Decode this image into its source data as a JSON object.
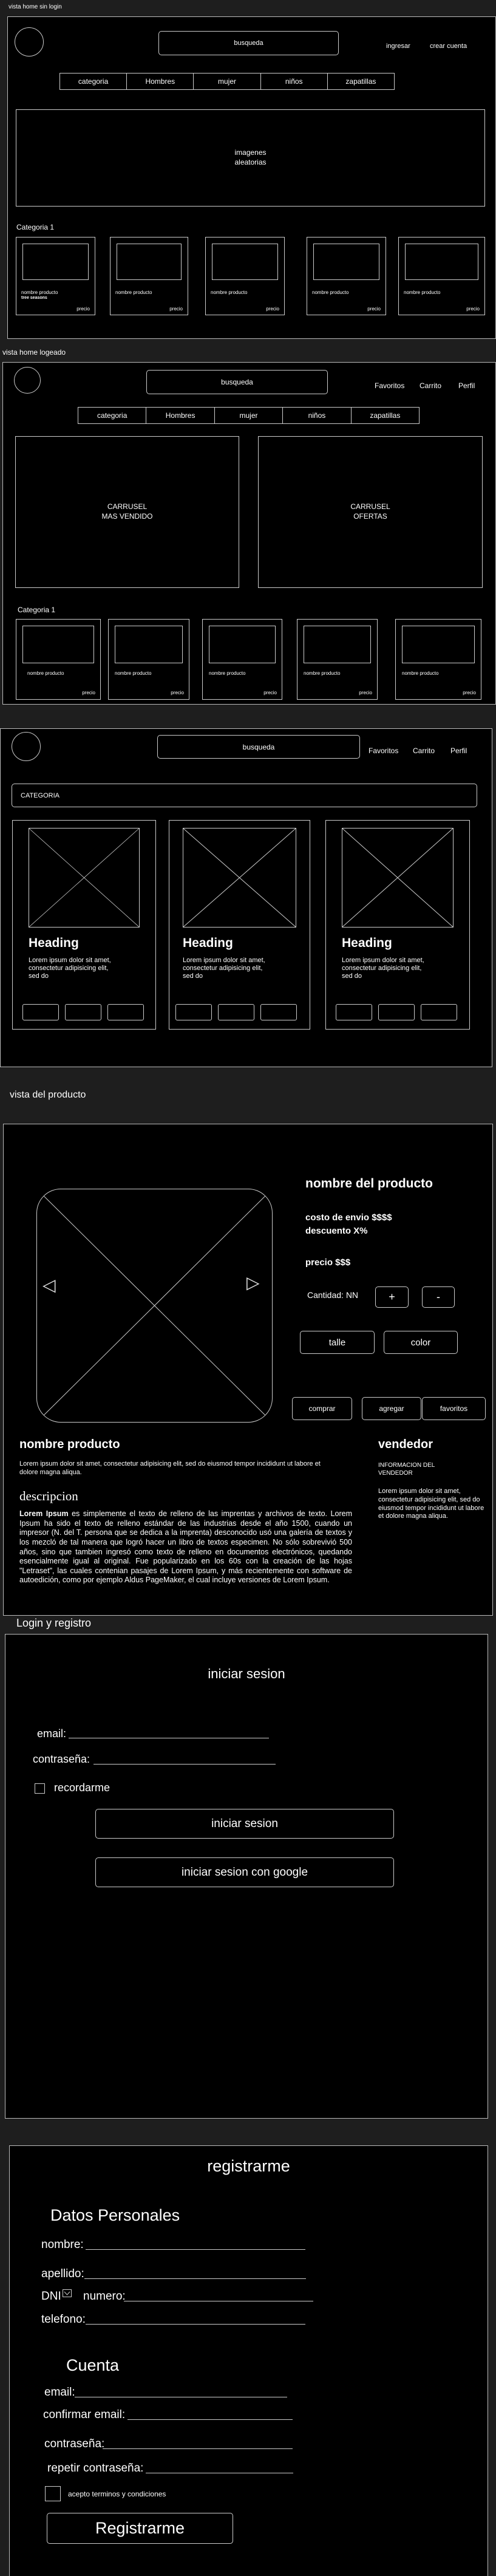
{
  "s1": {
    "title": "vista home sin login",
    "search": "busqueda",
    "links": [
      "ingresar",
      "crear cuenta"
    ],
    "cats": [
      "categoria",
      "Hombres",
      "mujer",
      "niños",
      "zapatillas"
    ],
    "hero": [
      "imagenes",
      "aleatorias"
    ],
    "row_label": "Categoria 1",
    "product_name": "nombre producto",
    "product_extra": "tree seasons",
    "price": "precio"
  },
  "s2": {
    "title": "vista home logeado",
    "search": "busqueda",
    "links": [
      "Favoritos",
      "Carrito",
      "Perfil"
    ],
    "cats": [
      "categoria",
      "Hombres",
      "mujer",
      "niños",
      "zapatillas"
    ],
    "carousel1": [
      "CARRUSEL",
      "MAS VENDIDO"
    ],
    "carousel2": [
      "CARRUSEL",
      "OFERTAS"
    ],
    "row_label": "Categoria 1",
    "product_name": "nombre producto",
    "price": "precio"
  },
  "s3": {
    "search": "busqueda",
    "links": [
      "Favoritos",
      "Carrito",
      "Perfil"
    ],
    "category": "CATEGORIA",
    "heading": "Heading",
    "body": "Lorem ipsum dolor sit amet, consectetur adipisicing elit, sed do"
  },
  "s4": {
    "title": "vista del producto",
    "name": "nombre del producto",
    "shipping": "costo de envio $$$$",
    "discount": "descuento X%",
    "price": "precio $$$",
    "qty": "Cantidad: NN",
    "plus": "+",
    "minus": "-",
    "size": "talle",
    "color": "color",
    "actions": [
      "comprar",
      "agregar",
      "favoritos"
    ],
    "left_arrow": "◁",
    "right_arrow": "▷",
    "prod_title": "nombre producto",
    "prod_short": "Lorem ipsum dolor sit amet, consectetur adipisicing elit, sed do eiusmod tempor incididunt ut labore et dolore magna aliqua.",
    "desc_title": "descripcion",
    "desc_bold": "Lorem Ipsum",
    "desc_text": " es simplemente el texto de relleno de las imprentas y archivos de texto. Lorem Ipsum ha sido el texto de relleno estándar de las industrias desde el año 1500, cuando un impresor (N. del T. persona que se dedica a la imprenta) desconocido usó una galería de textos y los mezcló de tal manera que logró hacer un libro de textos especimen. No sólo sobrevivió 500 años, sino que tambien ingresó como texto de relleno en documentos electrónicos, quedando esencialmente igual al original. Fue popularizado en los 60s con la creación de las hojas \"Letraset\", las cuales contenian pasajes de Lorem Ipsum, y más recientemente con software de autoedición, como por ejemplo Aldus PageMaker, el cual incluye versiones de Lorem Ipsum.",
    "seller_title": "vendedor",
    "seller_info": "INFORMACION DEL VENDEDOR",
    "seller_text": "Lorem ipsum dolor sit amet, consectetur adipisicing elit, sed do eiusmod tempor incididunt ut labore et dolore magna aliqua."
  },
  "s5": {
    "title": "Login y registro",
    "login_title": "iniciar sesion",
    "email": "email:",
    "password": "contraseña:",
    "remember": "recordarme",
    "login_btn": "iniciar sesion",
    "google_btn": "iniciar sesion con google"
  },
  "s6": {
    "title": "registrarme",
    "personal": "Datos Personales",
    "name": "nombre:",
    "surname": "apellido:",
    "dni": "DNI",
    "number": "numero:",
    "phone": "telefono:",
    "account": "Cuenta",
    "email": "email:",
    "confirm_email": "confirmar email:",
    "password": "contraseña:",
    "repeat_password": "repetir contraseña:",
    "terms": "acepto terminos y condiciones",
    "register_btn": "Registrarme"
  }
}
